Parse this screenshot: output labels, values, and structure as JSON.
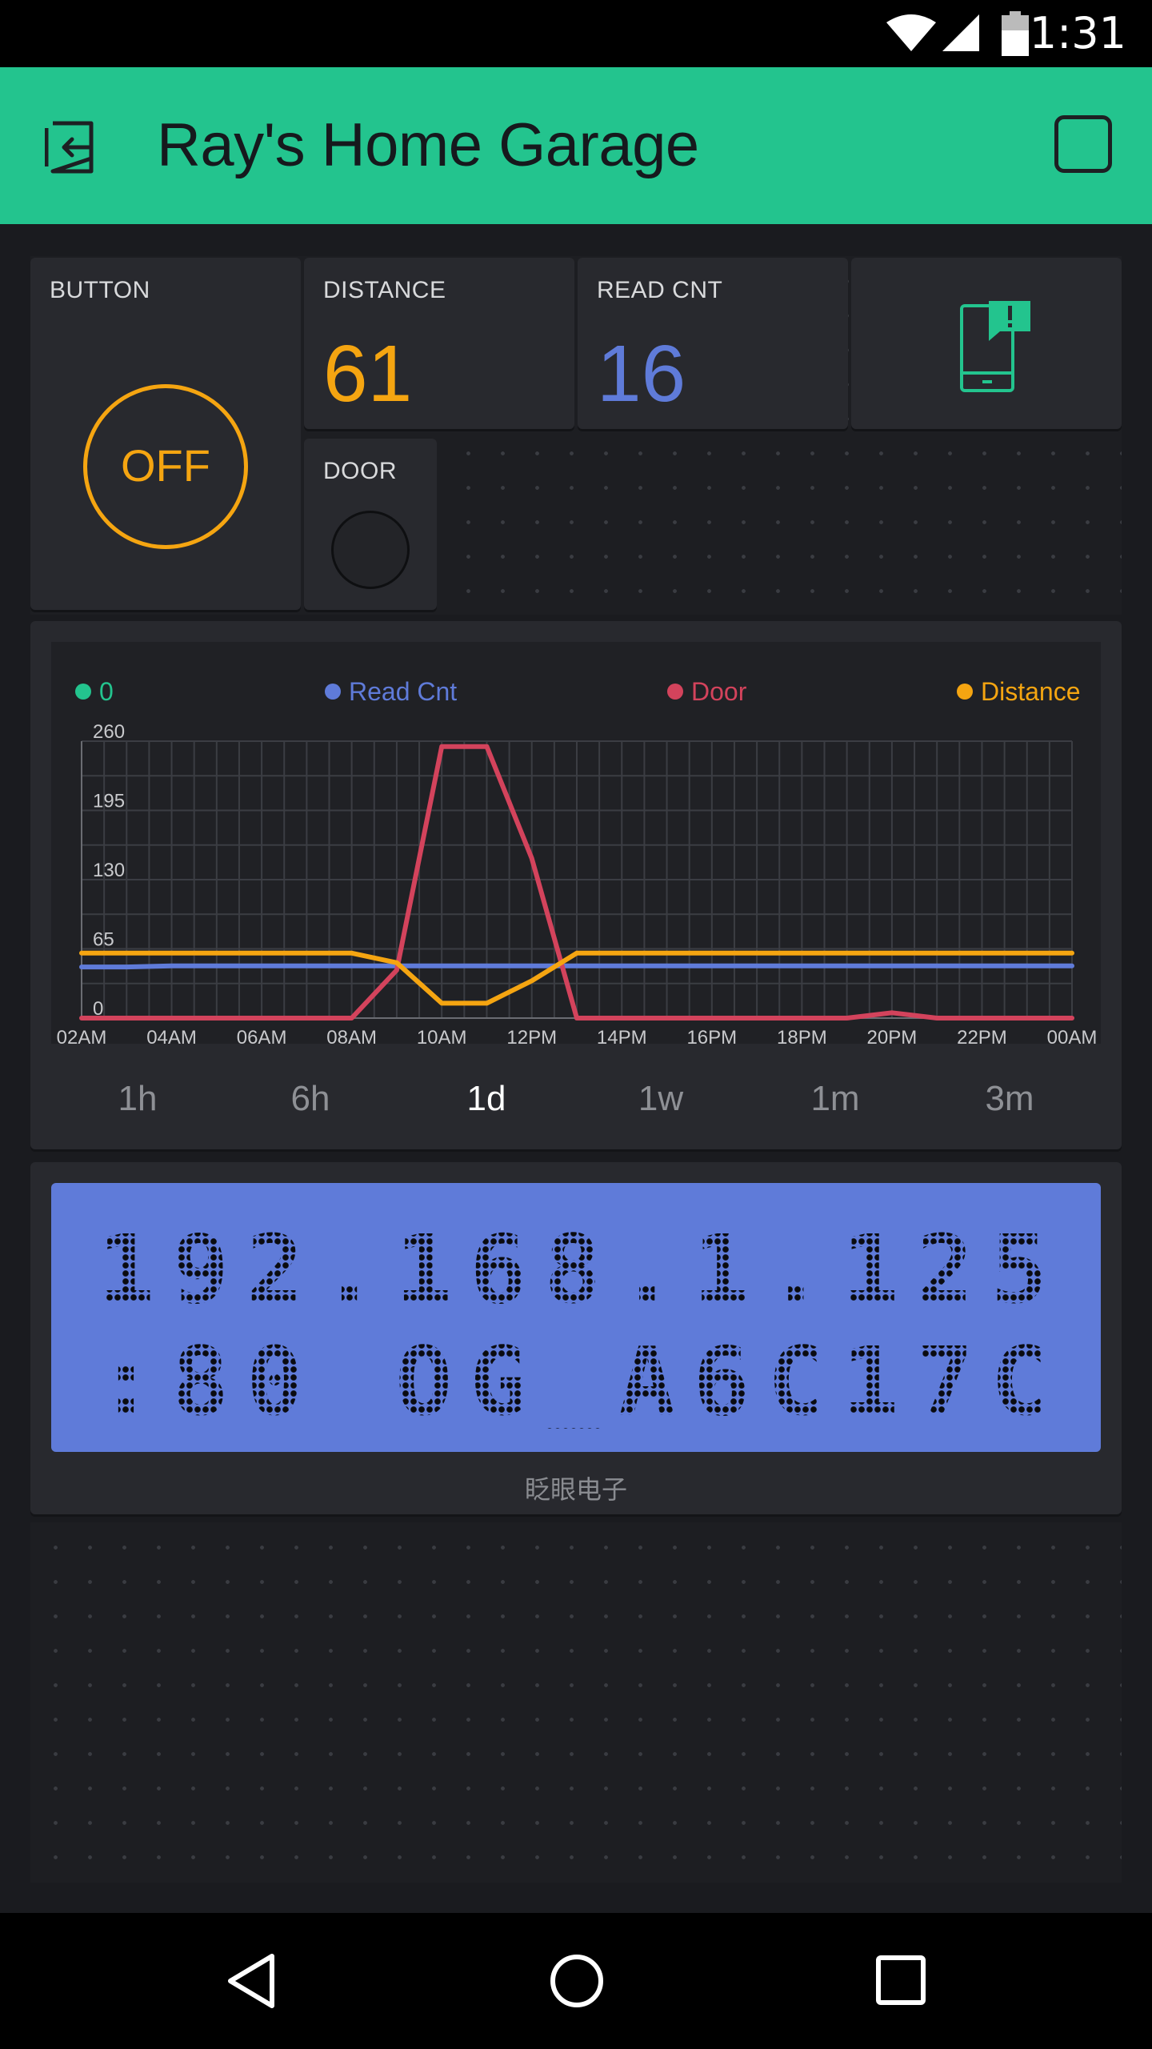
{
  "status_bar": {
    "time": "1:31"
  },
  "header": {
    "title": "Ray's Home Garage"
  },
  "widgets": {
    "button": {
      "label": "BUTTON",
      "state": "OFF"
    },
    "distance": {
      "label": "DISTANCE",
      "value": "61"
    },
    "read_cnt": {
      "label": "READ CNT",
      "value": "16"
    },
    "door": {
      "label": "DOOR"
    }
  },
  "colors": {
    "accent": "#23c48e",
    "orange": "#f5a511",
    "blue": "#5f7bd9",
    "red": "#d3435c",
    "background": "#1a1b1f",
    "tile": "#28292e"
  },
  "chart": {
    "legend": [
      {
        "name": "0",
        "color": "#23c48e"
      },
      {
        "name": "Read Cnt",
        "color": "#5f7bd9"
      },
      {
        "name": "Door",
        "color": "#d3435c"
      },
      {
        "name": "Distance",
        "color": "#f5a511"
      }
    ],
    "periods": [
      "1h",
      "6h",
      "1d",
      "1w",
      "1m",
      "3m"
    ],
    "selected_period": "1d"
  },
  "chart_data": {
    "type": "line",
    "x": [
      "02AM",
      "03AM",
      "04AM",
      "05AM",
      "06AM",
      "07AM",
      "08AM",
      "09AM",
      "10AM",
      "11AM",
      "12PM",
      "13PM",
      "14PM",
      "15PM",
      "16PM",
      "17PM",
      "18PM",
      "19PM",
      "20PM",
      "21PM",
      "22PM",
      "23PM",
      "00AM"
    ],
    "x_tick_labels": [
      "02AM",
      "04AM",
      "06AM",
      "08AM",
      "10AM",
      "12PM",
      "14PM",
      "16PM",
      "18PM",
      "20PM",
      "22PM",
      "00AM"
    ],
    "y_tick_labels": [
      "0",
      "65",
      "130",
      "195",
      "260"
    ],
    "ylim": [
      0,
      260
    ],
    "grid": true,
    "legend_position": "top",
    "series": [
      {
        "name": "Read Cnt",
        "color": "#5f7bd9",
        "values": [
          48,
          48,
          49,
          49,
          49,
          49,
          49,
          49,
          49,
          49,
          49,
          49,
          49,
          49,
          49,
          49,
          49,
          49,
          49,
          49,
          49,
          49,
          49
        ]
      },
      {
        "name": "Door",
        "color": "#d3435c",
        "values": [
          0,
          0,
          0,
          0,
          0,
          0,
          0,
          45,
          255,
          255,
          150,
          0,
          0,
          0,
          0,
          0,
          0,
          0,
          5,
          0,
          0,
          0,
          0
        ]
      },
      {
        "name": "Distance",
        "color": "#f5a511",
        "values": [
          61,
          61,
          61,
          61,
          61,
          61,
          61,
          52,
          14,
          14,
          35,
          61,
          61,
          61,
          61,
          61,
          61,
          61,
          61,
          61,
          61,
          61,
          61
        ]
      }
    ]
  },
  "lcd": {
    "line1": "192.168.1.125",
    "line2": ":80 OG_A6C17C",
    "caption": "眨眼电子"
  }
}
